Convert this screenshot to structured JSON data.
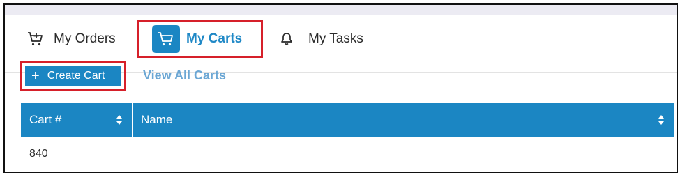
{
  "tabs": {
    "orders_label": "My Orders",
    "carts_label": "My Carts",
    "tasks_label": "My Tasks",
    "active": "My Carts"
  },
  "actions": {
    "create_cart_label": "Create Cart",
    "view_all_label": "View All Carts"
  },
  "table": {
    "columns": [
      "Cart #",
      "Name"
    ],
    "rows": [
      [
        "840",
        ""
      ]
    ]
  },
  "colors": {
    "accent": "#1b86c3",
    "highlight_border": "#d6202a",
    "link": "#6ca7d4"
  }
}
